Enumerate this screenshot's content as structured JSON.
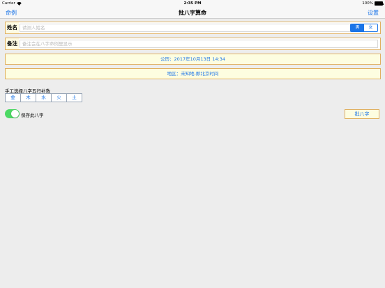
{
  "status_bar": {
    "carrier": "Carrier",
    "time": "2:35 PM",
    "battery": "100%"
  },
  "nav": {
    "left": "命例",
    "title": "批八字算命",
    "right": "设置"
  },
  "name_field": {
    "label": "姓名",
    "placeholder": "请测人姓名",
    "gender_male": "男",
    "gender_female": "女"
  },
  "note_field": {
    "label": "备注",
    "placeholder": "备注会在八字命例里显示"
  },
  "calendar": {
    "text": "公历：2017年10月13日 14:34"
  },
  "region": {
    "text": "地区：未知地-即北京时间"
  },
  "elements": {
    "label": "手工选择八字五行补救",
    "items": [
      "金",
      "木",
      "水",
      "火",
      "土"
    ]
  },
  "save_toggle": {
    "label": "保存此八字",
    "on": true
  },
  "bazi_button": {
    "label": "批八字"
  },
  "colors": {
    "accent": "#1a74e8",
    "border": "#e0b060",
    "toggle_on": "#4cd964"
  }
}
